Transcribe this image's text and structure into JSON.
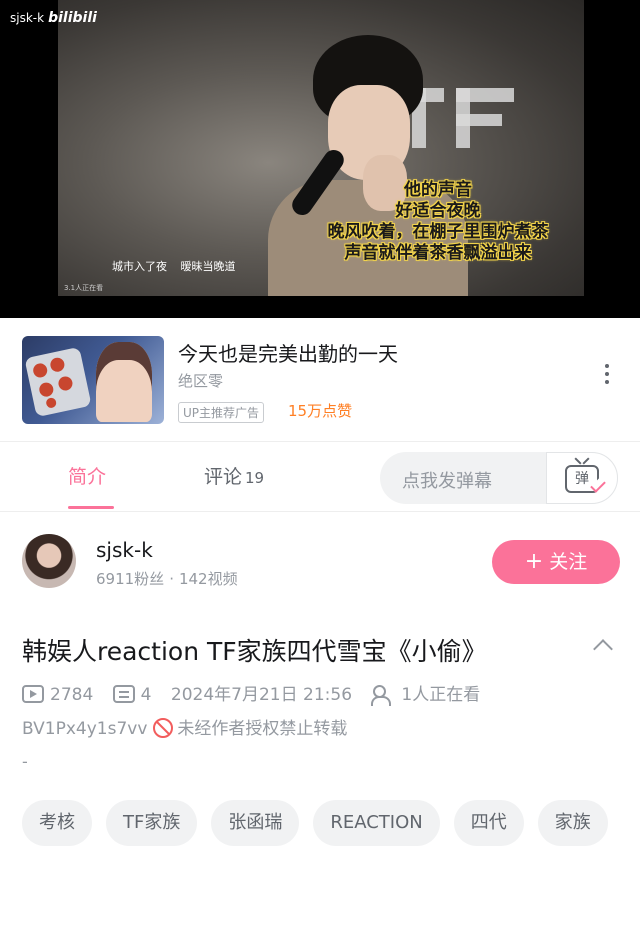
{
  "player": {
    "watermark_user": "sjsk-k",
    "watermark_brand": "bilibili",
    "subtitles": [
      "他的声音",
      "好适合夜晚",
      "晚风吹着，在棚子里围炉煮茶",
      "声音就伴着茶香飘溢出来"
    ],
    "small_captions": [
      "城市入了夜",
      "暧昧当晚道"
    ],
    "tiny_mark": "3.1人正在看",
    "progress_fraction": 0.09
  },
  "ad": {
    "title": "今天也是完美出勤的一天",
    "author": "绝区零",
    "tag": "UP主推荐广告",
    "likes": "15万点赞"
  },
  "tabs": [
    {
      "label": "简介",
      "count": ""
    },
    {
      "label": "评论",
      "count": "19"
    }
  ],
  "danmaku": {
    "placeholder": "点我发弹幕",
    "button_label": "弹"
  },
  "uploader": {
    "name": "sjsk-k",
    "fans": "6911粉丝",
    "videos": "142视频",
    "follow_label": "关注"
  },
  "video": {
    "title": "韩娱人reaction TF家族四代雪宝《小偷》",
    "views": "2784",
    "danmaku_count": "4",
    "date": "2024年7月21日 21:56",
    "watching": "1人正在看",
    "bvid": "BV1Px4y1s7vv",
    "copyright": "未经作者授权禁止转载",
    "description": "-"
  },
  "tags": [
    "考核",
    "TF家族",
    "张函瑞",
    "REACTION",
    "四代",
    "家族"
  ],
  "colors": {
    "accent": "#fb7299",
    "likes": "#ff7f24",
    "ban": "#f25d5d"
  }
}
